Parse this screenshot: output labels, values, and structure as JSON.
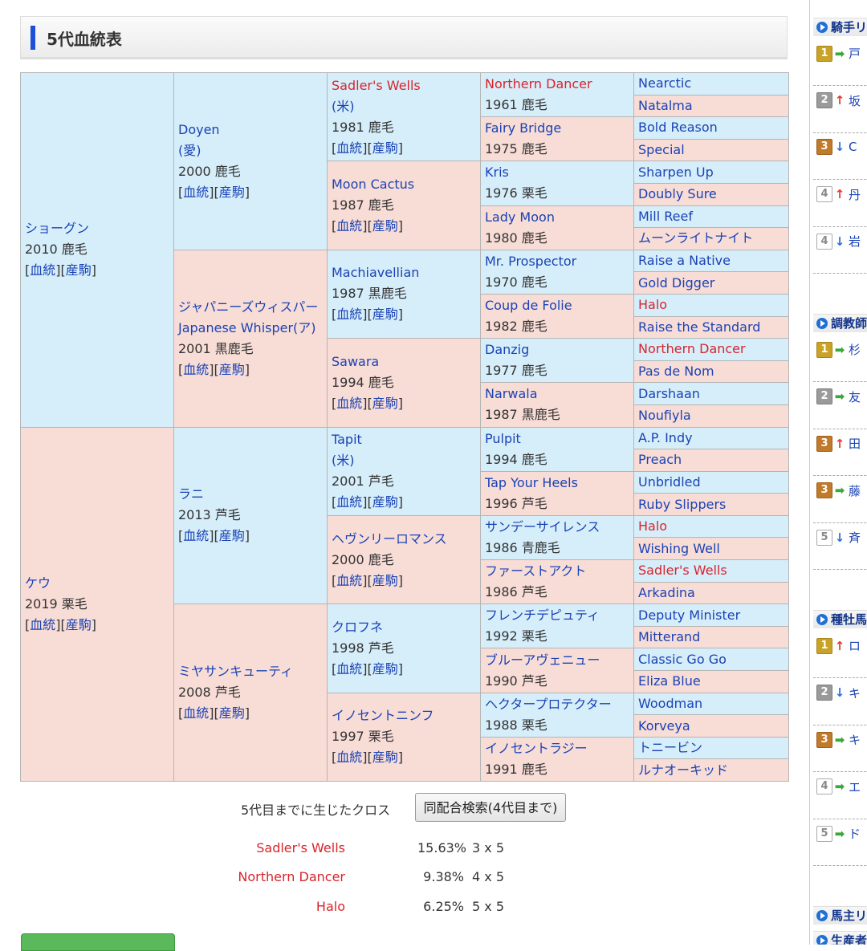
{
  "section_title": "5代血統表",
  "links_label": [
    "[",
    "血統",
    "][",
    "産駒",
    "]"
  ],
  "pedigree": {
    "g1": [
      {
        "name": "ショーグン",
        "info": "2010 鹿毛",
        "color": "blue",
        "bg": "m"
      },
      {
        "name": "ケウ",
        "info": "2019 栗毛",
        "color": "blue",
        "bg": "f"
      }
    ],
    "g2": [
      {
        "name": "Doyen",
        "origin": "(愛)",
        "info": "2000 鹿毛",
        "color": "blue",
        "bg": "m"
      },
      {
        "name": "ジャパニーズウィスパー",
        "origin": "Japanese Whisper(ア)",
        "info": "2001 黒鹿毛",
        "color": "blue",
        "bg": "f"
      },
      {
        "name": "ラニ",
        "info": "2013 芦毛",
        "color": "blue",
        "bg": "m"
      },
      {
        "name": "ミヤサンキューティ",
        "info": "2008 芦毛",
        "color": "blue",
        "bg": "f"
      }
    ],
    "g3": [
      {
        "name": "Sadler's Wells",
        "origin": "(米)",
        "info": "1981 鹿毛",
        "color": "red",
        "bg": "m"
      },
      {
        "name": "Moon Cactus",
        "info": "1987 鹿毛",
        "color": "blue",
        "bg": "f"
      },
      {
        "name": "Machiavellian",
        "info": "1987 黒鹿毛",
        "color": "blue",
        "bg": "m"
      },
      {
        "name": "Sawara",
        "info": "1994 鹿毛",
        "color": "blue",
        "bg": "f"
      },
      {
        "name": "Tapit",
        "origin": "(米)",
        "info": "2001 芦毛",
        "color": "blue",
        "bg": "m"
      },
      {
        "name": "ヘヴンリーロマンス",
        "info": "2000 鹿毛",
        "color": "blue",
        "bg": "f"
      },
      {
        "name": "クロフネ",
        "info": "1998 芦毛",
        "color": "blue",
        "bg": "m"
      },
      {
        "name": "イノセントニンフ",
        "info": "1997 栗毛",
        "color": "blue",
        "bg": "f"
      }
    ],
    "g4": [
      {
        "name": "Northern Dancer",
        "info": "1961 鹿毛",
        "color": "red",
        "bg": "m"
      },
      {
        "name": "Fairy Bridge",
        "info": "1975 鹿毛",
        "color": "blue",
        "bg": "f"
      },
      {
        "name": "Kris",
        "info": "1976 栗毛",
        "color": "blue",
        "bg": "m"
      },
      {
        "name": "Lady Moon",
        "info": "1980 鹿毛",
        "color": "blue",
        "bg": "f"
      },
      {
        "name": "Mr. Prospector",
        "info": "1970 鹿毛",
        "color": "blue",
        "bg": "m"
      },
      {
        "name": "Coup de Folie",
        "info": "1982 鹿毛",
        "color": "blue",
        "bg": "f"
      },
      {
        "name": "Danzig",
        "info": "1977 鹿毛",
        "color": "blue",
        "bg": "m"
      },
      {
        "name": "Narwala",
        "info": "1987 黒鹿毛",
        "color": "blue",
        "bg": "f"
      },
      {
        "name": "Pulpit",
        "info": "1994 鹿毛",
        "color": "blue",
        "bg": "m"
      },
      {
        "name": "Tap Your Heels",
        "info": "1996 芦毛",
        "color": "blue",
        "bg": "f"
      },
      {
        "name": "サンデーサイレンス",
        "info": "1986 青鹿毛",
        "color": "blue",
        "bg": "m"
      },
      {
        "name": "ファーストアクト",
        "info": "1986 芦毛",
        "color": "blue",
        "bg": "f"
      },
      {
        "name": "フレンチデピュティ",
        "info": "1992 栗毛",
        "color": "blue",
        "bg": "m"
      },
      {
        "name": "ブルーアヴェニュー",
        "info": "1990 芦毛",
        "color": "blue",
        "bg": "f"
      },
      {
        "name": "ヘクタープロテクター",
        "info": "1988 栗毛",
        "color": "blue",
        "bg": "m"
      },
      {
        "name": "イノセントラジー",
        "info": "1991 鹿毛",
        "color": "blue",
        "bg": "f"
      }
    ],
    "g5": [
      {
        "name": "Nearctic",
        "color": "blue",
        "bg": "m"
      },
      {
        "name": "Natalma",
        "color": "blue",
        "bg": "f"
      },
      {
        "name": "Bold Reason",
        "color": "blue",
        "bg": "m"
      },
      {
        "name": "Special",
        "color": "blue",
        "bg": "f"
      },
      {
        "name": "Sharpen Up",
        "color": "blue",
        "bg": "m"
      },
      {
        "name": "Doubly Sure",
        "color": "blue",
        "bg": "f"
      },
      {
        "name": "Mill Reef",
        "color": "blue",
        "bg": "m"
      },
      {
        "name": "ムーンライトナイト",
        "color": "blue",
        "bg": "f"
      },
      {
        "name": "Raise a Native",
        "color": "blue",
        "bg": "m"
      },
      {
        "name": "Gold Digger",
        "color": "blue",
        "bg": "f"
      },
      {
        "name": "Halo",
        "color": "red",
        "bg": "m"
      },
      {
        "name": "Raise the Standard",
        "color": "blue",
        "bg": "f"
      },
      {
        "name": "Northern Dancer",
        "color": "red",
        "bg": "m"
      },
      {
        "name": "Pas de Nom",
        "color": "blue",
        "bg": "f"
      },
      {
        "name": "Darshaan",
        "color": "blue",
        "bg": "m"
      },
      {
        "name": "Noufiyla",
        "color": "blue",
        "bg": "f"
      },
      {
        "name": "A.P. Indy",
        "color": "blue",
        "bg": "m"
      },
      {
        "name": "Preach",
        "color": "blue",
        "bg": "f"
      },
      {
        "name": "Unbridled",
        "color": "blue",
        "bg": "m"
      },
      {
        "name": "Ruby Slippers",
        "color": "blue",
        "bg": "f"
      },
      {
        "name": "Halo",
        "color": "red",
        "bg": "m"
      },
      {
        "name": "Wishing Well",
        "color": "blue",
        "bg": "f"
      },
      {
        "name": "Sadler's Wells",
        "color": "red",
        "bg": "m"
      },
      {
        "name": "Arkadina",
        "color": "blue",
        "bg": "f"
      },
      {
        "name": "Deputy Minister",
        "color": "blue",
        "bg": "m"
      },
      {
        "name": "Mitterand",
        "color": "blue",
        "bg": "f"
      },
      {
        "name": "Classic Go Go",
        "color": "blue",
        "bg": "m"
      },
      {
        "name": "Eliza Blue",
        "color": "blue",
        "bg": "f"
      },
      {
        "name": "Woodman",
        "color": "blue",
        "bg": "m"
      },
      {
        "name": "Korveya",
        "color": "blue",
        "bg": "f"
      },
      {
        "name": "トニービン",
        "color": "blue",
        "bg": "m"
      },
      {
        "name": "ルナオーキッド",
        "color": "blue",
        "bg": "f"
      }
    ]
  },
  "cross": {
    "label": "5代目までに生じたクロス",
    "button": "同配合検索(4代目まで)",
    "rows": [
      {
        "name": "Sadler's Wells",
        "pct": "15.63%",
        "gen": "3 x 5"
      },
      {
        "name": "Northern Dancer",
        "pct": "9.38%",
        "gen": "4 x 5"
      },
      {
        "name": "Halo",
        "pct": "6.25%",
        "gen": "5 x 5"
      }
    ]
  },
  "sidebar": {
    "sections": [
      {
        "title": "騎手リ",
        "items": [
          {
            "rank": "1",
            "style": "gold",
            "arrow": "right",
            "name": "戸"
          },
          {
            "rank": "2",
            "style": "silver",
            "arrow": "up",
            "name": "坂"
          },
          {
            "rank": "3",
            "style": "bronze",
            "arrow": "down",
            "name": "C"
          },
          {
            "rank": "4",
            "style": "plain",
            "arrow": "up",
            "name": "丹"
          },
          {
            "rank": "4",
            "style": "plain",
            "arrow": "down",
            "name": "岩"
          }
        ]
      },
      {
        "title": "調教師",
        "items": [
          {
            "rank": "1",
            "style": "gold",
            "arrow": "right",
            "name": "杉"
          },
          {
            "rank": "2",
            "style": "silver",
            "arrow": "right",
            "name": "友"
          },
          {
            "rank": "3",
            "style": "bronze",
            "arrow": "up",
            "name": "田"
          },
          {
            "rank": "3",
            "style": "bronze",
            "arrow": "right",
            "name": "藤"
          },
          {
            "rank": "5",
            "style": "plain",
            "arrow": "down",
            "name": "斉"
          }
        ]
      },
      {
        "title": "種牡馬",
        "items": [
          {
            "rank": "1",
            "style": "gold",
            "arrow": "up",
            "name": "ロ"
          },
          {
            "rank": "2",
            "style": "silver",
            "arrow": "down",
            "name": "キ"
          },
          {
            "rank": "3",
            "style": "bronze",
            "arrow": "right",
            "name": "キ"
          },
          {
            "rank": "4",
            "style": "plain",
            "arrow": "right",
            "name": "エ"
          },
          {
            "rank": "5",
            "style": "plain",
            "arrow": "right",
            "name": "ド"
          }
        ]
      },
      {
        "title": "馬主リ",
        "items": []
      },
      {
        "title": "生産者",
        "items": []
      }
    ]
  }
}
